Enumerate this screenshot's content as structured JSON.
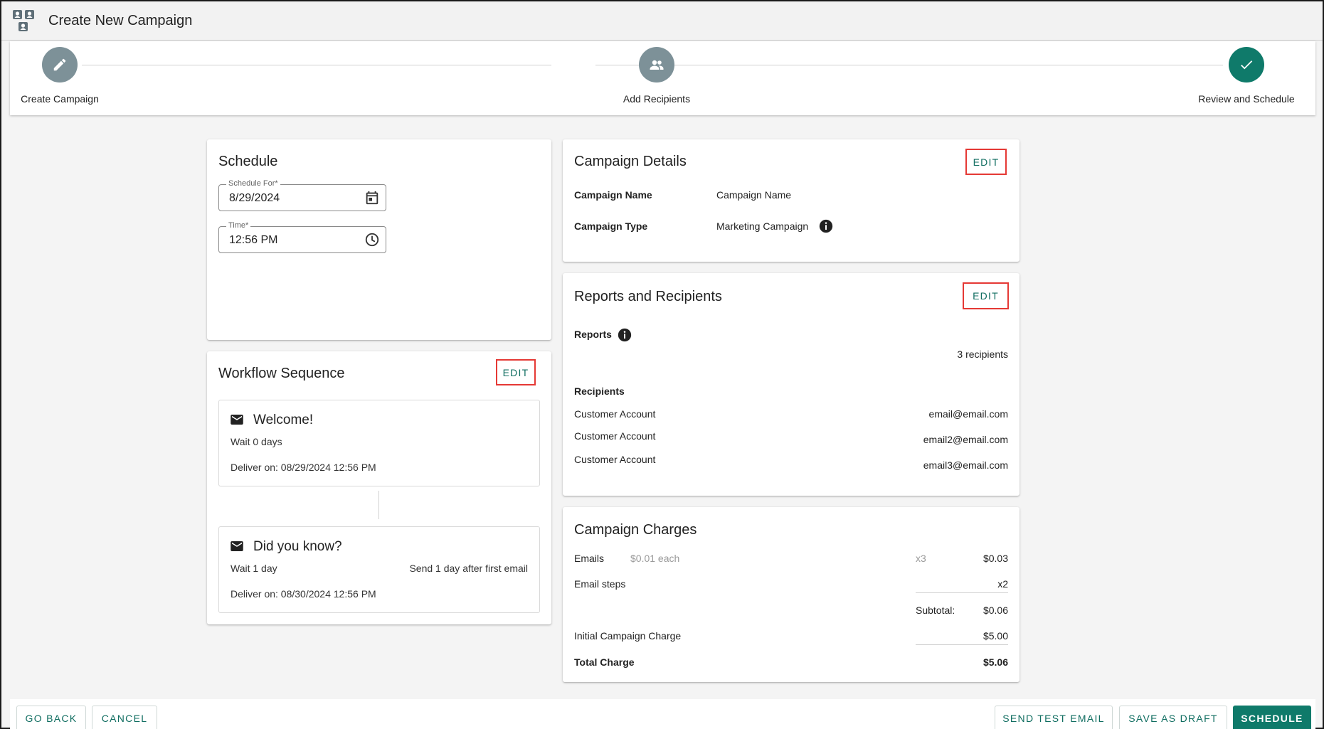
{
  "header": {
    "title": "Create New Campaign",
    "logo_icon": "contacts-group-icon"
  },
  "stepper": {
    "steps": [
      {
        "label": "Create Campaign",
        "icon": "pencil-icon",
        "state": "complete"
      },
      {
        "label": "Add Recipients",
        "icon": "people-icon",
        "state": "complete"
      },
      {
        "label": "Review and Schedule",
        "icon": "check-icon",
        "state": "active"
      }
    ]
  },
  "schedule": {
    "title": "Schedule",
    "date_label": "Schedule For*",
    "date_value": "8/29/2024",
    "time_label": "Time*",
    "time_value": "12:56 PM"
  },
  "workflow": {
    "title": "Workflow Sequence",
    "edit_label": "EDIT",
    "items": [
      {
        "title": "Welcome!",
        "wait": "Wait 0 days",
        "note": "",
        "deliver": "Deliver on: 08/29/2024 12:56 PM"
      },
      {
        "title": "Did you know?",
        "wait": "Wait 1 day",
        "note": "Send 1 day after first email",
        "deliver": "Deliver on: 08/30/2024 12:56 PM"
      }
    ]
  },
  "campaign_details": {
    "title": "Campaign Details",
    "edit_label": "EDIT",
    "name_label": "Campaign Name",
    "name_value": "Campaign Name",
    "type_label": "Campaign Type",
    "type_value": "Marketing Campaign"
  },
  "reports_recipients": {
    "title": "Reports and Recipients",
    "edit_label": "EDIT",
    "reports_label": "Reports",
    "recipient_count": "3 recipients",
    "recipients_label": "Recipients",
    "recipients": [
      {
        "account": "Customer Account",
        "email": "email@email.com"
      },
      {
        "account": "Customer Account",
        "email": "email2@email.com"
      },
      {
        "account": "Customer Account",
        "email": "email3@email.com"
      }
    ]
  },
  "charges": {
    "title": "Campaign Charges",
    "emails_label": "Emails",
    "emails_rate": "$0.01 each",
    "emails_qty": "x3",
    "emails_amount": "$0.03",
    "steps_label": "Email steps",
    "steps_qty": "x2",
    "subtotal_label": "Subtotal:",
    "subtotal_amount": "$0.06",
    "initial_label": "Initial Campaign Charge",
    "initial_amount": "$5.00",
    "total_label": "Total Charge",
    "total_amount": "$5.06"
  },
  "footer": {
    "go_back": "GO BACK",
    "cancel": "CANCEL",
    "send_test": "SEND TEST EMAIL",
    "save_draft": "SAVE AS DRAFT",
    "schedule": "SCHEDULE"
  },
  "colors": {
    "accent": "#0f7a6a",
    "step_grey": "#7d9198",
    "highlight_border": "#e53935"
  }
}
